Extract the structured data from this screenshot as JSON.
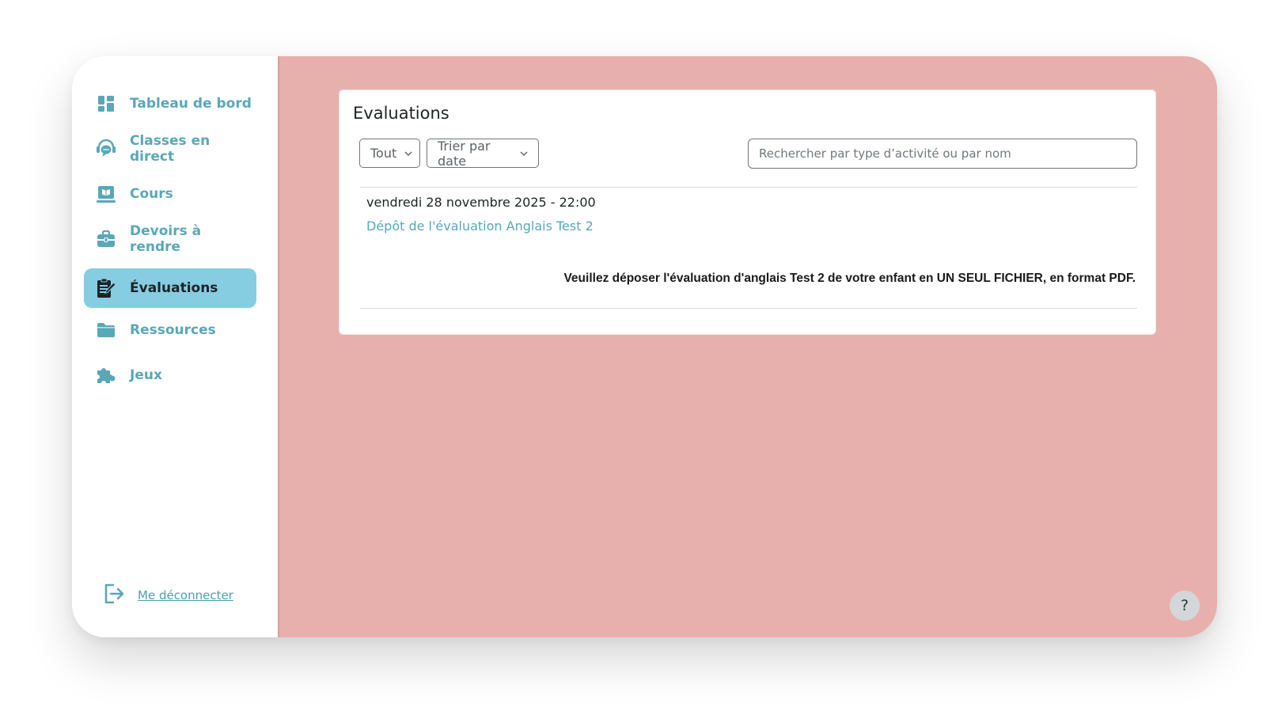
{
  "sidebar": {
    "items": [
      {
        "label": "Tableau de bord",
        "icon": "dashboard-icon"
      },
      {
        "label": "Classes en direct",
        "icon": "live-class-icon"
      },
      {
        "label": "Cours",
        "icon": "course-book-icon"
      },
      {
        "label": "Devoirs à rendre",
        "icon": "briefcase-icon"
      },
      {
        "label": "Évaluations",
        "icon": "clipboard-edit-icon",
        "active": true
      },
      {
        "label": "Ressources",
        "icon": "folder-icon"
      },
      {
        "label": "Jeux",
        "icon": "puzzle-icon"
      }
    ],
    "logout_label": "Me déconnecter"
  },
  "main": {
    "title": "Evaluations",
    "filters": {
      "type_value": "Tout",
      "sort_value": "Trier par date"
    },
    "search": {
      "placeholder": "Rechercher par type d’activité ou par nom"
    },
    "entry": {
      "date": "vendredi 28 novembre 2025 - 22:00",
      "title": "Dépôt de l'évaluation Anglais Test 2",
      "description": "Veuillez déposer l'évaluation d'anglais Test 2 de votre enfant en UN SEUL FICHIER, en format PDF."
    },
    "help_label": "?"
  },
  "colors": {
    "accent": "#5aa7b8",
    "active_bg": "#86cde2",
    "main_bg": "#e8b0ac"
  }
}
